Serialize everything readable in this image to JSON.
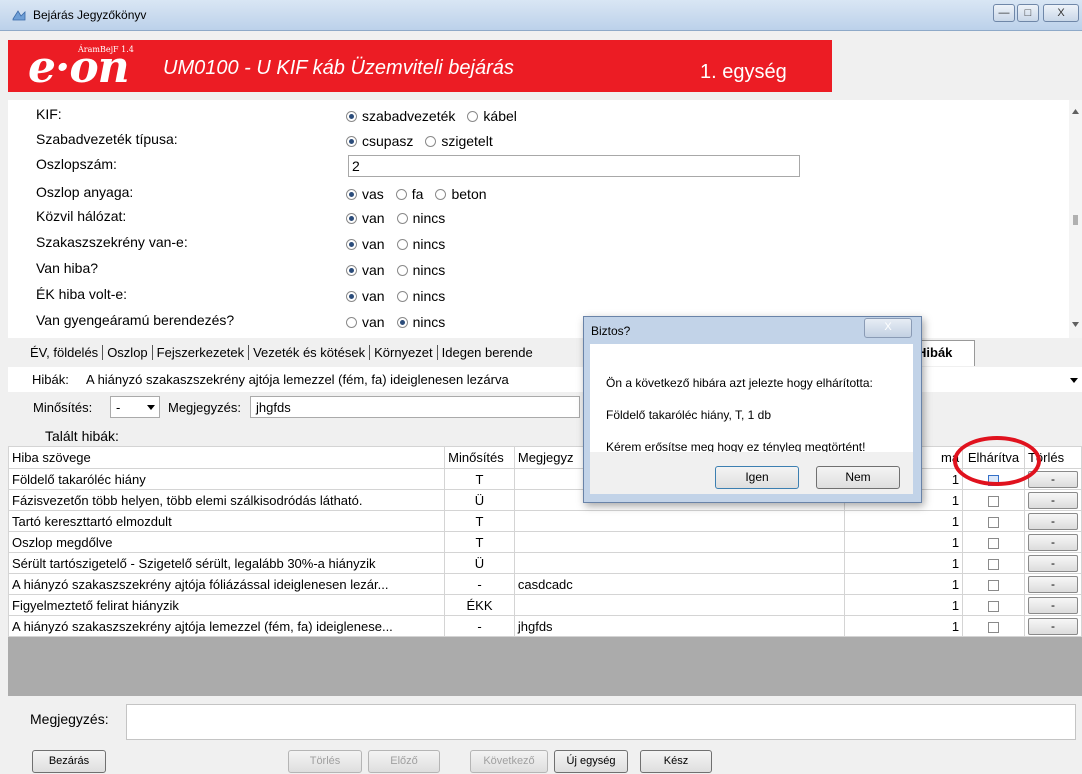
{
  "window": {
    "title": "Bejárás Jegyzőkönyv",
    "min": "—",
    "max": "□",
    "close": "X"
  },
  "header": {
    "logo": "e·on",
    "app_version": "ÁramBejF 1.4",
    "title": "UM0100 - U KIF káb Üzemviteli bejárás",
    "unit": "1. egység"
  },
  "form": {
    "kif": {
      "label": "KIF:",
      "options": [
        "szabadvezeték",
        "kábel"
      ],
      "selected": 0
    },
    "tipus": {
      "label": "Szabadvezeték típusa:",
      "options": [
        "csupasz",
        "szigetelt"
      ],
      "selected": 0
    },
    "oszlopszam": {
      "label": "Oszlopszám:",
      "value": "2"
    },
    "anyag": {
      "label": "Oszlop anyaga:",
      "options": [
        "vas",
        "fa",
        "beton"
      ],
      "selected": 0
    },
    "kozvil": {
      "label": "Közvil hálózat:",
      "options": [
        "van",
        "nincs"
      ],
      "selected": 0
    },
    "szakasz": {
      "label": "Szakaszszekrény van-e:",
      "options": [
        "van",
        "nincs"
      ],
      "selected": 0
    },
    "hiba": {
      "label": "Van hiba?",
      "options": [
        "van",
        "nincs"
      ],
      "selected": 0
    },
    "ek": {
      "label": "ÉK hiba volt-e:",
      "options": [
        "van",
        "nincs"
      ],
      "selected": 0
    },
    "gyenge": {
      "label": "Van gyengeáramú berendezés?",
      "options": [
        "van",
        "nincs"
      ],
      "selected": 1
    }
  },
  "tabs": [
    "ÉV, földelés",
    "Oszlop",
    "Fejszerkezetek",
    "Vezeték és kötések",
    "Környezet",
    "Idegen berende"
  ],
  "active_tab": "Hibák",
  "hibak": {
    "label": "Hibák:",
    "value": "A hiányzó szakaszszekrény ajtója lemezzel (fém, fa) ideiglenesen lezárva"
  },
  "minosites": {
    "label": "Minősítés:",
    "value": "-"
  },
  "megjegyzes_top": {
    "label": "Megjegyzés:",
    "value": "jhgfds"
  },
  "talalt": {
    "label": "Talált hibák:"
  },
  "grid": {
    "columns": [
      "Hiba szövege",
      "Minősítés",
      "Megjegyz",
      "ma",
      "Elhárítva",
      "Törlés"
    ],
    "del_label": "-",
    "rows": [
      {
        "text": "Földelő takaróléc hiány",
        "min": "T",
        "note": "",
        "qty": "1"
      },
      {
        "text": "Fázisvezetőn több helyen, több elemi szálkisodródás látható.",
        "min": "Ü",
        "note": "",
        "qty": "1"
      },
      {
        "text": "Tartó kereszttartó elmozdult",
        "min": "T",
        "note": "",
        "qty": "1"
      },
      {
        "text": "Oszlop megdőlve",
        "min": "T",
        "note": "",
        "qty": "1"
      },
      {
        "text": "Sérült tartószigetelő - Szigetelő sérült, legalább 30%-a hiányzik",
        "min": "Ü",
        "note": "",
        "qty": "1"
      },
      {
        "text": "A hiányzó szakaszszekrény ajtója fóliázással ideiglenesen lezár...",
        "min": "-",
        "note": "casdcadc",
        "qty": "1"
      },
      {
        "text": "Figyelmeztető felirat hiányzik",
        "min": "ÉKK",
        "note": "",
        "qty": "1"
      },
      {
        "text": "A hiányzó szakaszszekrény ajtója lemezzel (fém, fa) ideiglenese...",
        "min": "-",
        "note": "jhgfds",
        "qty": "1"
      }
    ]
  },
  "dialog": {
    "title": "Biztos?",
    "close": "X",
    "line1": "Ön a következő hibára azt jelezte hogy elhárította:",
    "line2": "Földelő takaróléc hiány, T, 1 db",
    "line3": "Kérem erősítse meg hogy ez tényleg megtörtént!",
    "yes": "Igen",
    "no": "Nem"
  },
  "bottom": {
    "note_label": "Megjegyzés:",
    "close": "Bezárás",
    "delete": "Törlés",
    "prev": "Előző",
    "next": "Következő",
    "new_unit": "Új egység",
    "done": "Kész"
  }
}
